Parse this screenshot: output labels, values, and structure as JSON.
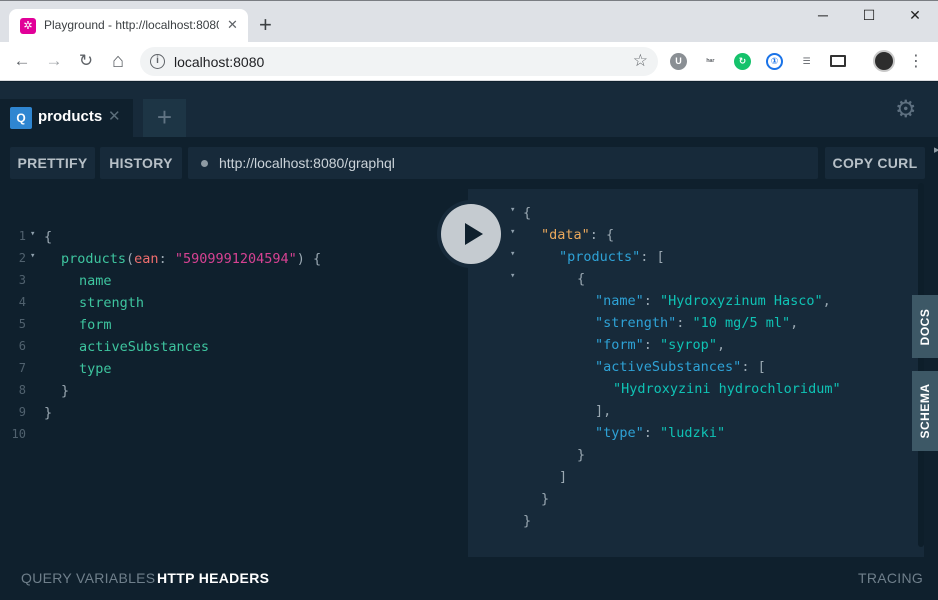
{
  "browser": {
    "tab_title": "Playground - http://localhost:8080",
    "tab_favicon": "✲",
    "tab_close": "✕",
    "new_tab": "+",
    "window_controls": [
      "─",
      "☐",
      "✕"
    ],
    "nav": {
      "back": "←",
      "forward": "→",
      "reload": "↻",
      "home": "⌂"
    },
    "url": "localhost:8080",
    "extensions": [
      "U",
      "ʰᵃʳ",
      "↻",
      "①",
      "☰"
    ]
  },
  "playground": {
    "tab": {
      "badge": "Q",
      "title": "products",
      "close": "✕"
    },
    "add_tab": "+",
    "settings_icon": "⚙",
    "buttons": {
      "prettify": "PRETTIFY",
      "history": "HISTORY",
      "copy_curl": "COPY CURL"
    },
    "endpoint": "http://localhost:8080/graphql",
    "side_tabs": {
      "docs": "DOCS",
      "schema": "SCHEMA"
    },
    "footer": {
      "query_variables": "QUERY VARIABLES",
      "http_headers": "HTTP HEADERS",
      "tracing": "TRACING"
    }
  },
  "query": {
    "line_numbers": [
      "1",
      "2",
      "3",
      "4",
      "5",
      "6",
      "7",
      "8",
      "9",
      "10"
    ],
    "open_brace": "{",
    "operation": "products",
    "arg_name": "ean",
    "arg_value": "\"5909991204594\"",
    "fields": [
      "name",
      "strength",
      "form",
      "activeSubstances",
      "type"
    ],
    "close_inner": "}",
    "close_outer": "}"
  },
  "response": {
    "data_key": "\"data\"",
    "products_key": "\"products\"",
    "name_key": "\"name\"",
    "name_value": "\"Hydroxyzinum Hasco\"",
    "strength_key": "\"strength\"",
    "strength_value": "\"10 mg/5 ml\"",
    "form_key": "\"form\"",
    "form_value": "\"syrop\"",
    "active_key": "\"activeSubstances\"",
    "active_value": "\"Hydroxyzini hydrochloridum\"",
    "type_key": "\"type\"",
    "type_value": "\"ludzki\""
  }
}
